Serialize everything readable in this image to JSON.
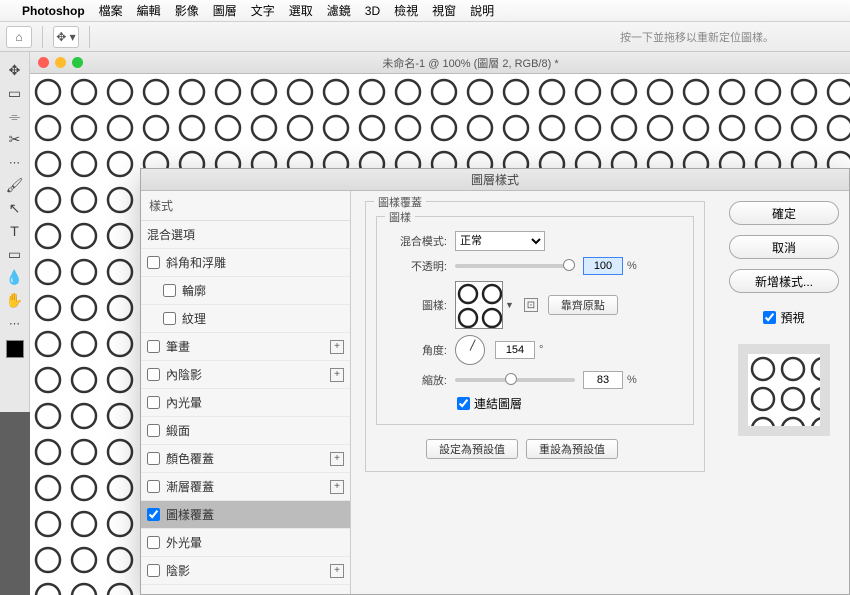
{
  "menubar": {
    "app": "Photoshop",
    "items": [
      "檔案",
      "編輯",
      "影像",
      "圖層",
      "文字",
      "選取",
      "濾鏡",
      "3D",
      "檢視",
      "視窗",
      "說明"
    ]
  },
  "optionbar": {
    "hint": "按一下並拖移以重新定位圖樣。"
  },
  "document": {
    "title": "未命名-1 @ 100% (圖層 2, RGB/8) *"
  },
  "dialog": {
    "title": "圖層樣式",
    "styles_header": "樣式",
    "blend_options": "混合選項",
    "styles": [
      {
        "label": "斜角和浮雕",
        "checked": false,
        "plus": false,
        "indent": 0
      },
      {
        "label": "輪廓",
        "checked": false,
        "plus": false,
        "indent": 1
      },
      {
        "label": "紋理",
        "checked": false,
        "plus": false,
        "indent": 1
      },
      {
        "label": "筆畫",
        "checked": false,
        "plus": true,
        "indent": 0
      },
      {
        "label": "內陰影",
        "checked": false,
        "plus": true,
        "indent": 0
      },
      {
        "label": "內光暈",
        "checked": false,
        "plus": false,
        "indent": 0
      },
      {
        "label": "緞面",
        "checked": false,
        "plus": false,
        "indent": 0
      },
      {
        "label": "顏色覆蓋",
        "checked": false,
        "plus": true,
        "indent": 0
      },
      {
        "label": "漸層覆蓋",
        "checked": false,
        "plus": true,
        "indent": 0
      },
      {
        "label": "圖樣覆蓋",
        "checked": true,
        "plus": false,
        "indent": 0,
        "selected": true
      },
      {
        "label": "外光暈",
        "checked": false,
        "plus": false,
        "indent": 0
      },
      {
        "label": "陰影",
        "checked": false,
        "plus": true,
        "indent": 0
      }
    ],
    "detail": {
      "section": "圖樣覆蓋",
      "group": "圖樣",
      "blend_mode_label": "混合模式:",
      "blend_mode_value": "正常",
      "opacity_label": "不透明:",
      "opacity_value": "100",
      "pattern_label": "圖樣:",
      "snap_origin": "靠齊原點",
      "angle_label": "角度:",
      "angle_value": "154",
      "scale_label": "縮放:",
      "scale_value": "83",
      "link_layer": "連結圖層",
      "make_default": "設定為預設值",
      "reset_default": "重設為預設值",
      "degree": "°",
      "percent": "%"
    },
    "buttons": {
      "ok": "確定",
      "cancel": "取消",
      "new_style": "新增樣式...",
      "preview": "預視"
    }
  }
}
